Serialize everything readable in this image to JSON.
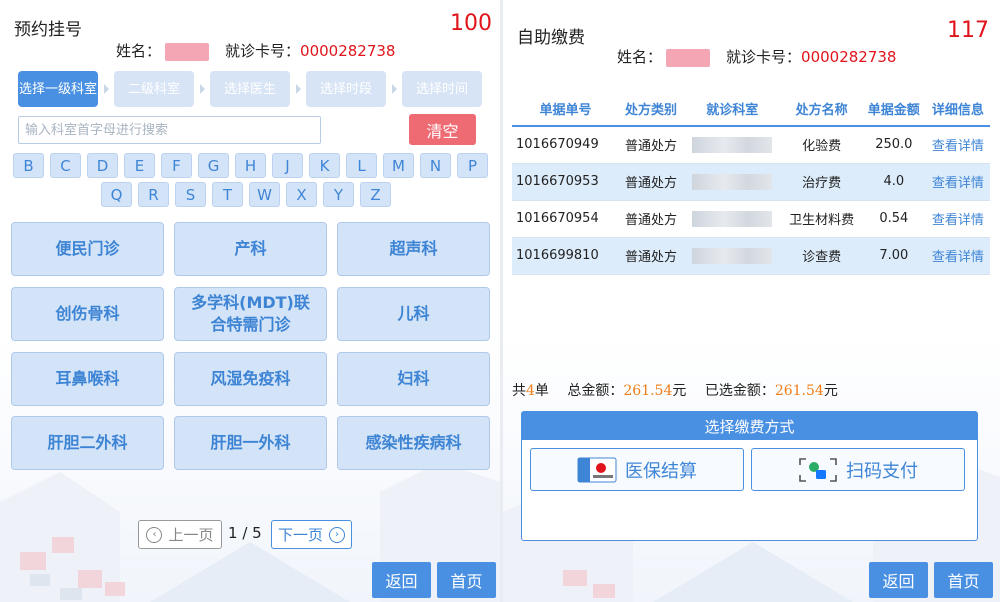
{
  "left": {
    "title": "预约挂号",
    "counter": "100",
    "patient": {
      "name_label": "姓名：",
      "card_label": "就诊卡号：",
      "card_number": "0000282738"
    },
    "steps": [
      {
        "label": "选择一级科室",
        "active": true
      },
      {
        "label": "二级科室",
        "active": false
      },
      {
        "label": "选择医生",
        "active": false
      },
      {
        "label": "选择时段",
        "active": false
      },
      {
        "label": "选择时间",
        "active": false
      }
    ],
    "search": {
      "placeholder": "输入科室首字母进行搜索",
      "value": ""
    },
    "clear_label": "清空",
    "letters_row1": [
      "B",
      "C",
      "D",
      "E",
      "F",
      "G",
      "H",
      "J",
      "K",
      "L",
      "M",
      "N",
      "P"
    ],
    "letters_row2": [
      "Q",
      "R",
      "S",
      "T",
      "W",
      "X",
      "Y",
      "Z"
    ],
    "departments": [
      "便民门诊",
      "产科",
      "超声科",
      "创伤骨科",
      "多学科(MDT)联合特需门诊",
      "儿科",
      "耳鼻喉科",
      "风湿免疫科",
      "妇科",
      "肝胆二外科",
      "肝胆一外科",
      "感染性疾病科"
    ],
    "pager": {
      "prev_label": "上一页",
      "current": "1",
      "separator": "/",
      "total": "5",
      "next_label": "下一页"
    },
    "back_label": "返回",
    "home_label": "首页"
  },
  "right": {
    "title": "自助缴费",
    "counter": "117",
    "patient": {
      "name_label": "姓名：",
      "card_label": "就诊卡号：",
      "card_number": "0000282738"
    },
    "table": {
      "headers": [
        "单据单号",
        "处方类别",
        "就诊科室",
        "处方名称",
        "单据金额",
        "详细信息"
      ],
      "rows": [
        {
          "bill_no": "1016670949",
          "type": "普通处方",
          "name": "化验费",
          "amount": "250.0",
          "detail": "查看详情"
        },
        {
          "bill_no": "1016670953",
          "type": "普通处方",
          "name": "治疗费",
          "amount": "4.0",
          "detail": "查看详情"
        },
        {
          "bill_no": "1016670954",
          "type": "普通处方",
          "name": "卫生材料费",
          "amount": "0.54",
          "detail": "查看详情"
        },
        {
          "bill_no": "1016699810",
          "type": "普通处方",
          "name": "诊查费",
          "amount": "7.00",
          "detail": "查看详情"
        }
      ]
    },
    "summary": {
      "count_prefix": "共",
      "count": "4",
      "count_suffix": "单",
      "total_label": "总金额：",
      "total": "261.54",
      "total_unit": "元",
      "selected_label": "已选金额：",
      "selected": "261.54",
      "selected_unit": "元"
    },
    "payment": {
      "title": "选择缴费方式",
      "insurance_label": "医保结算",
      "scan_label": "扫码支付"
    },
    "back_label": "返回",
    "home_label": "首页"
  },
  "colors": {
    "accent": "#4a90e2",
    "red": "#e0141b",
    "orange": "#f07d18",
    "key_bg": "#d4e4f8",
    "clear_bg": "#ef6b74"
  }
}
